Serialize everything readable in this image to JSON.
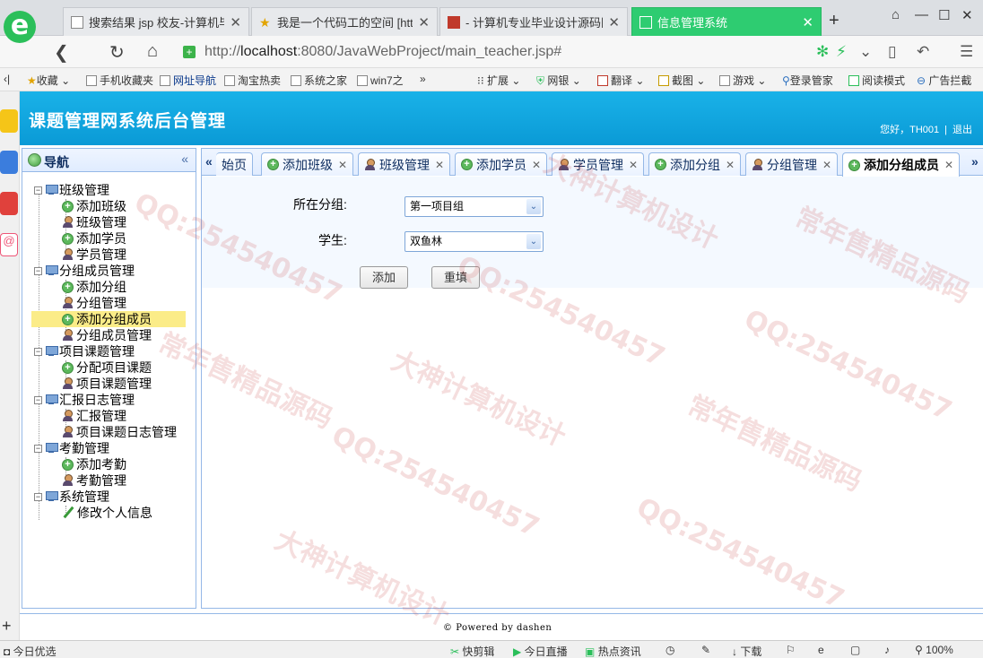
{
  "browser": {
    "tabs": [
      {
        "label": "搜索结果 jsp 校友-计算机毕"
      },
      {
        "label": "我是一个代码工的空间 [http"
      },
      {
        "label": "- 计算机专业毕业设计源码网"
      },
      {
        "label": "信息管理系统"
      }
    ],
    "url": {
      "prefix": "http://",
      "host": "localhost",
      "rest": ":8080/JavaWebProject/main_teacher.jsp#"
    },
    "bookmarks": [
      "收藏",
      "手机收藏夹",
      "网址导航",
      "淘宝热卖",
      "系统之家",
      "win7之"
    ],
    "toolbar": [
      "扩展",
      "网银",
      "翻译",
      "截图",
      "游戏",
      "登录管家",
      "阅读模式",
      "广告拦截"
    ],
    "status": {
      "left": "今日优选",
      "items": [
        "快剪辑",
        "今日直播",
        "热点资讯",
        "下载"
      ],
      "zoom": "100%"
    }
  },
  "app": {
    "title": "课题管理网系统后台管理",
    "greeting": "您好，TH001",
    "logout": "退出",
    "footer": "Powered by dashen"
  },
  "nav": {
    "title": "导航",
    "groups": [
      {
        "label": "班级管理",
        "items": [
          "添加班级",
          "班级管理",
          "添加学员",
          "学员管理"
        ]
      },
      {
        "label": "分组成员管理",
        "items": [
          "添加分组",
          "分组管理",
          "添加分组成员",
          "分组成员管理"
        ]
      },
      {
        "label": "项目课题管理",
        "items": [
          "分配项目课题",
          "项目课题管理"
        ]
      },
      {
        "label": "汇报日志管理",
        "items": [
          "汇报管理",
          "项目课题日志管理"
        ]
      },
      {
        "label": "考勤管理",
        "items": [
          "添加考勤",
          "考勤管理"
        ]
      },
      {
        "label": "系统管理",
        "items": [
          "修改个人信息"
        ]
      }
    ]
  },
  "content_tabs": [
    "始页",
    "添加班级",
    "班级管理",
    "添加学员",
    "学员管理",
    "添加分组",
    "分组管理",
    "添加分组成员"
  ],
  "form": {
    "group_label": "所在分组:",
    "group_value": "第一项目组",
    "student_label": "学生:",
    "student_value": "双鱼林",
    "add_button": "添加",
    "reset_button": "重填"
  },
  "watermarks": [
    "QQ:254540457",
    "大神计算机设计",
    "常年售精品源码"
  ]
}
